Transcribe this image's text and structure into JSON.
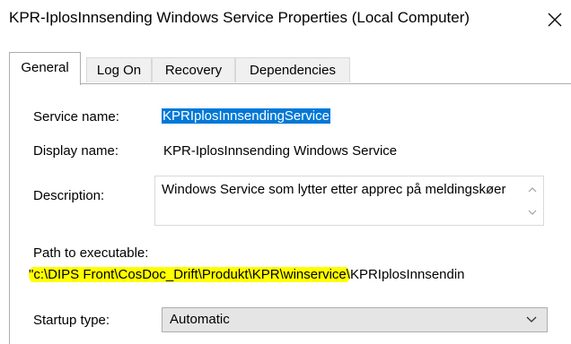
{
  "window": {
    "title": "KPR-IplosInnsending Windows Service Properties (Local Computer)",
    "close_icon": "close-icon"
  },
  "tabs": [
    {
      "label": "General",
      "active": true
    },
    {
      "label": "Log On",
      "active": false
    },
    {
      "label": "Recovery",
      "active": false
    },
    {
      "label": "Dependencies",
      "active": false
    }
  ],
  "general": {
    "service_name_label": "Service name:",
    "service_name_value": "KPRIplosInnsendingService",
    "display_name_label": "Display name:",
    "display_name_value": "KPR-IplosInnsending Windows Service",
    "description_label": "Description:",
    "description_value": "Windows Service som lytter etter apprec på meldingskøer",
    "path_label": "Path to executable:",
    "path_highlighted": "\"c:\\DIPS Front\\CosDoc_Drift\\Produkt\\KPR\\winservice\\",
    "path_rest": "KPRIplosInnsendin",
    "highlight_color": "#ffff00",
    "selection_color": "#0078d7",
    "startup_type_label": "Startup type:",
    "startup_type_value": "Automatic"
  }
}
